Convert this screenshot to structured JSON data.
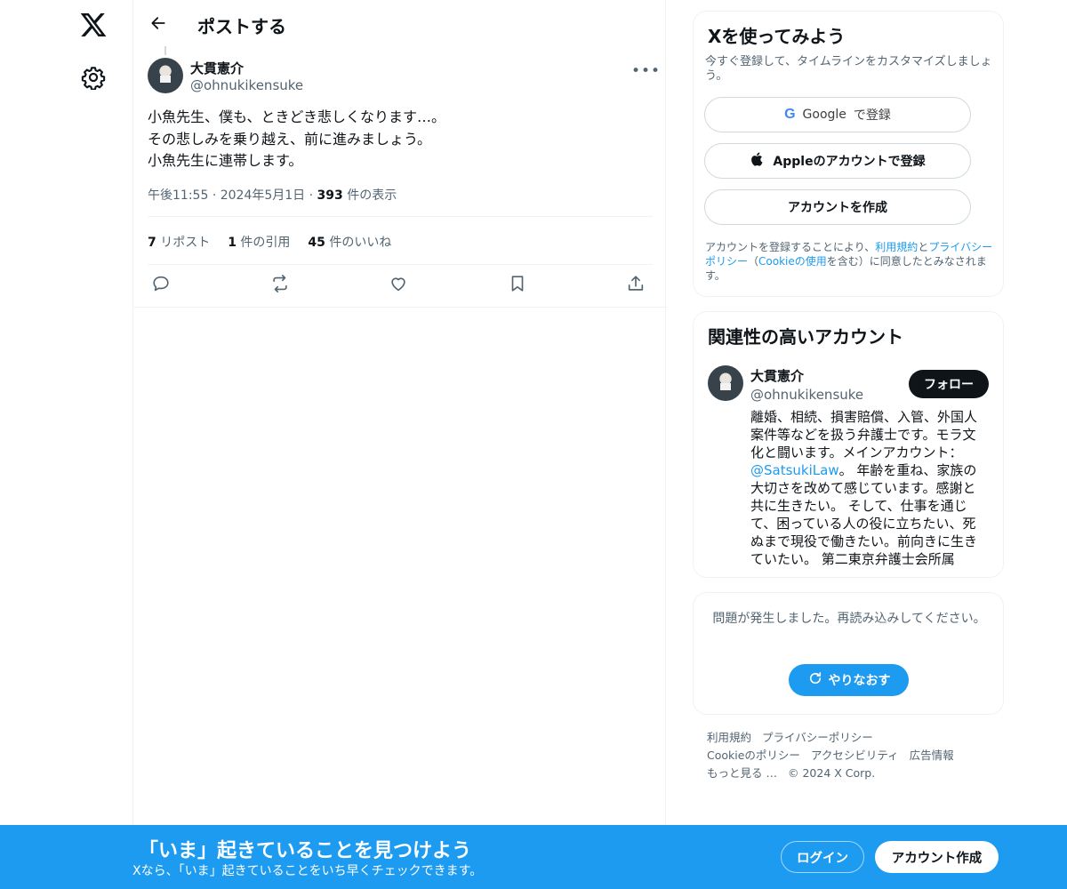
{
  "header": {
    "title": "ポストする"
  },
  "tweet": {
    "author_name": "大貫憲介",
    "author_handle": "@ohnukikensuke",
    "text": "小魚先生、僕も、ときどき悲しくなります…。\nその悲しみを乗り越え、前に進みましょう。\n小魚先生に連帯します。",
    "time": "午後11:55",
    "dot1": "·",
    "date": "2024年5月1日",
    "dot2": "·",
    "views_count": "393",
    "views_label": "件の表示",
    "reposts_count": "7",
    "reposts_label": "リポスト",
    "quotes_count": "1",
    "quotes_label": "件の引用",
    "likes_count": "45",
    "likes_label": "件のいいね",
    "more_icon": "more-icon",
    "actions": [
      "reply-icon",
      "repost-icon",
      "like-icon",
      "bookmark-icon",
      "share-icon"
    ]
  },
  "signup_card": {
    "title": "Xを使ってみよう",
    "subtitle": "今すぐ登録して、タイムラインをカスタマイズしましょう。",
    "google_label": "で登録",
    "google_brand": "Google",
    "apple_label": "Appleのアカウントで登録",
    "create_label": "アカウントを作成",
    "legal_prefix": "アカウントを登録することにより、",
    "legal_terms": "利用規約",
    "legal_and": "と",
    "legal_privacy": "プライバシーポリシー",
    "legal_paren_open": "（",
    "legal_cookie": "Cookieの使用",
    "legal_suffix": "を含む）に同意したとみなされます。"
  },
  "related": {
    "title": "関連性の高いアカウント",
    "name": "大貫憲介",
    "handle": "@ohnukikensuke",
    "follow_label": "フォロー",
    "bio_part1": "離婚、相続、損害賠償、入管、外国人案件等などを扱う弁護士です。モラ文化と闘います。メインアカウント：",
    "bio_link": "@SatsukiLaw",
    "bio_part2": "。 年齢を重ね、家族の大切さを改めて感じています。感謝と共に生きたい。 そして、仕事を通じて、困っている人の役に立ちたい、死ぬまで現役で働きたい。前向きに生きていたい。 第二東京弁護士会所属"
  },
  "error_card": {
    "message": "問題が発生しました。再読み込みしてください。",
    "retry_label": "やりなおす"
  },
  "footer": {
    "links": [
      "利用規約",
      "プライバシーポリシー",
      "Cookieのポリシー",
      "アクセシビリティ",
      "広告情報",
      "もっと見る …"
    ],
    "copyright": "© 2024 X Corp."
  },
  "banner": {
    "title": "「いま」起きていることを見つけよう",
    "subtitle": "Xなら、「いま」起きていることをいち早くチェックできます。",
    "login_label": "ログイン",
    "signup_label": "アカウント作成"
  },
  "colors": {
    "accent": "#1d9bf0",
    "text": "#0f1419",
    "muted": "#536471",
    "border": "#eff3f4"
  }
}
